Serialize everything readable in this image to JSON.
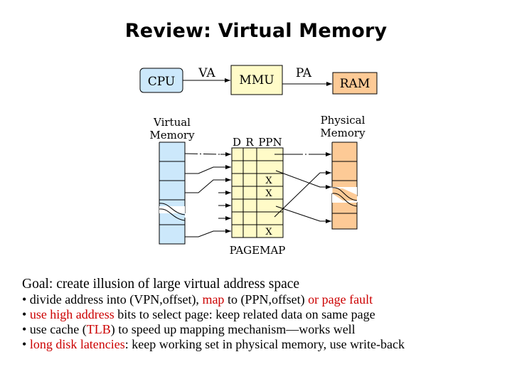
{
  "title": "Review: Virtual Memory",
  "flow": {
    "cpu": "CPU",
    "mmu": "MMU",
    "ram": "RAM",
    "va": "VA",
    "pa": "PA",
    "colors": {
      "cpu": "#cce8fb",
      "mmu": "#fffbc8",
      "ram": "#fdca96"
    }
  },
  "diagram": {
    "virtual_label_1": "Virtual",
    "virtual_label_2": "Memory",
    "physical_label_1": "Physical",
    "physical_label_2": "Memory",
    "pagemap_label": "PAGEMAP",
    "col_d": "D",
    "col_r": "R",
    "col_ppn": "PPN",
    "pagemap_rows": [
      "",
      "",
      "X",
      "X",
      "",
      "",
      "X"
    ]
  },
  "text": {
    "goal": "Goal: create illusion of large virtual address space",
    "bullets": [
      [
        {
          "t": "• divide address into (VPN,offset), ",
          "red": false
        },
        {
          "t": "map",
          "red": true
        },
        {
          "t": " to (PPN,offset) ",
          "red": false
        },
        {
          "t": "or page fault",
          "red": true
        }
      ],
      [
        {
          "t": "• ",
          "red": false
        },
        {
          "t": "use high address",
          "red": true
        },
        {
          "t": " bits to select page: keep related data on same page",
          "red": false
        }
      ],
      [
        {
          "t": "• use cache (",
          "red": false
        },
        {
          "t": "TLB",
          "red": true
        },
        {
          "t": ") to speed up mapping mechanism—works well",
          "red": false
        }
      ],
      [
        {
          "t": "• ",
          "red": false
        },
        {
          "t": "long disk latencies",
          "red": true
        },
        {
          "t": ": keep working set in physical memory, use write-back",
          "red": false
        }
      ]
    ]
  }
}
